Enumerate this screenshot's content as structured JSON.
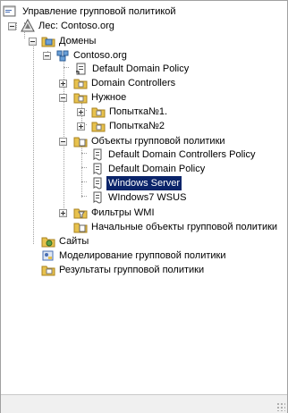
{
  "tree": {
    "root": "Управление групповой политикой",
    "forest": "Лес: Contoso.org",
    "domains": "Домены",
    "domain": "Contoso.org",
    "default_domain_policy_link": "Default Domain Policy",
    "domain_controllers_ou": "Domain Controllers",
    "ou_nuzhnoe": "Нужное",
    "ou_popytka1": "Попытка№1.",
    "ou_popytka2": "Попытка№2",
    "gpo_container": "Объекты групповой политики",
    "gpo_ddcp": "Default Domain Controllers Policy",
    "gpo_ddp": "Default Domain Policy",
    "gpo_windows_server": "Windows Server",
    "gpo_windows7_wsus": "WIndows7 WSUS",
    "wmi_filters": "Фильтры WMI",
    "starter_gpos": "Начальные объекты групповой политики",
    "sites": "Сайты",
    "modeling": "Моделирование групповой политики",
    "results": "Результаты групповой политики"
  },
  "selected": "Windows Server",
  "colors": {
    "selection_bg": "#0a246a",
    "folder": "#e8c24d",
    "script_icon": "#ffffff"
  }
}
